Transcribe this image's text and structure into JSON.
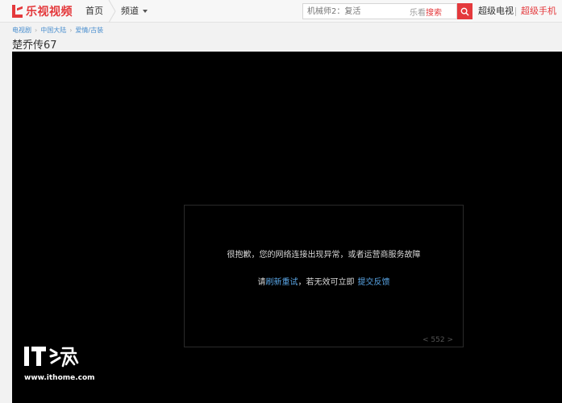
{
  "header": {
    "logo_text": "乐视视频",
    "nav_home": "首页",
    "nav_channel": "频道",
    "search": {
      "placeholder": "机械师2：复活",
      "hint_prefix": "乐看",
      "hint_accent": "搜索"
    },
    "link_tv": "超级电视",
    "link_phone": "超级手机",
    "accent_color": "#e4393c"
  },
  "breadcrumb": {
    "items": [
      "电视剧",
      "中国大陆",
      "爱情/古装"
    ]
  },
  "page": {
    "title": "楚乔传67"
  },
  "player": {
    "error_message": "很抱歉，您的网络连接出现异常，或者运营商服务故障",
    "retry_prefix": "请",
    "retry_link": "刷新重试",
    "retry_middle": "，若无效可立即",
    "feedback_link": "提交反馈",
    "error_code": "< 552 >"
  },
  "watermark": {
    "url": "www.ithome.com"
  },
  "icons": {
    "logo": "letv-logo-icon",
    "search": "search-icon",
    "dropdown": "chevron-down-icon"
  }
}
